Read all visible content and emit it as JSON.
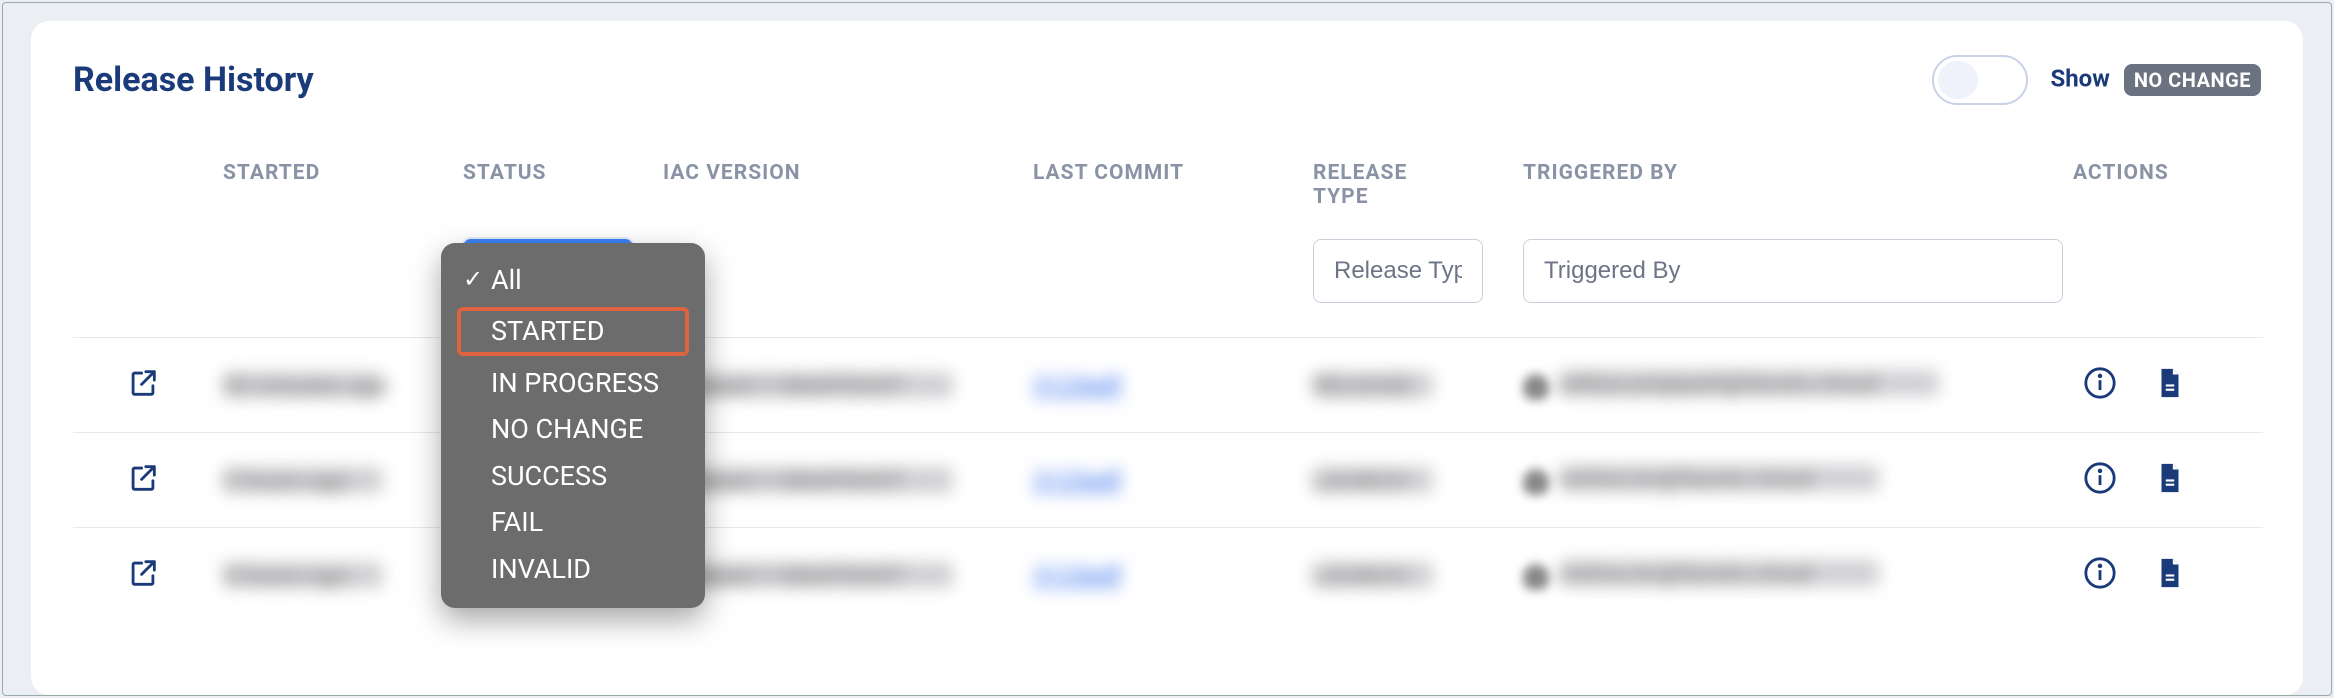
{
  "page": {
    "title": "Release History",
    "show_label": "Show",
    "badge_label": "NO CHANGE",
    "toggle_on": false
  },
  "columns": {
    "started": "STARTED",
    "status": "STATUS",
    "iac": "IAC VERSION",
    "commit": "LAST COMMIT",
    "rtype": "RELEASE TYPE",
    "rtype_multiline_a": "RELEASE",
    "rtype_multiline_b": "TYPE",
    "triggered": "TRIGGERED BY",
    "actions": "ACTIONS"
  },
  "filters": {
    "status_dropdown": {
      "selected": "All",
      "highlighted": "STARTED",
      "options": [
        "All",
        "STARTED",
        "IN PROGRESS",
        "NO CHANGE",
        "SUCCESS",
        "FAIL",
        "INVALID"
      ]
    },
    "release_type_placeholder": "Release Type",
    "triggered_by_placeholder": "Triggered By"
  },
  "rows": [
    {
      "started": "53 minutes ago",
      "status_color": "blue",
      "iac": "release0.1-SNAPSHOT",
      "commit": "3123edf",
      "rtype": "RELEASE",
      "triggered": "aditya.prajapati@facets.cloud"
    },
    {
      "started": "2 hours ago",
      "status_color": "blue",
      "iac": "release0.1-SNAPSHOT",
      "commit": "3123edf",
      "rtype": "LAUNCH",
      "triggered": "vishnu.kv@facets.cloud"
    },
    {
      "started": "3 hours ago",
      "status_color": "red",
      "iac": "release0.1-SNAPSHOT",
      "commit": "3123edf",
      "rtype": "LAUNCH",
      "triggered": "vishnu.kv@facets.cloud"
    }
  ]
}
